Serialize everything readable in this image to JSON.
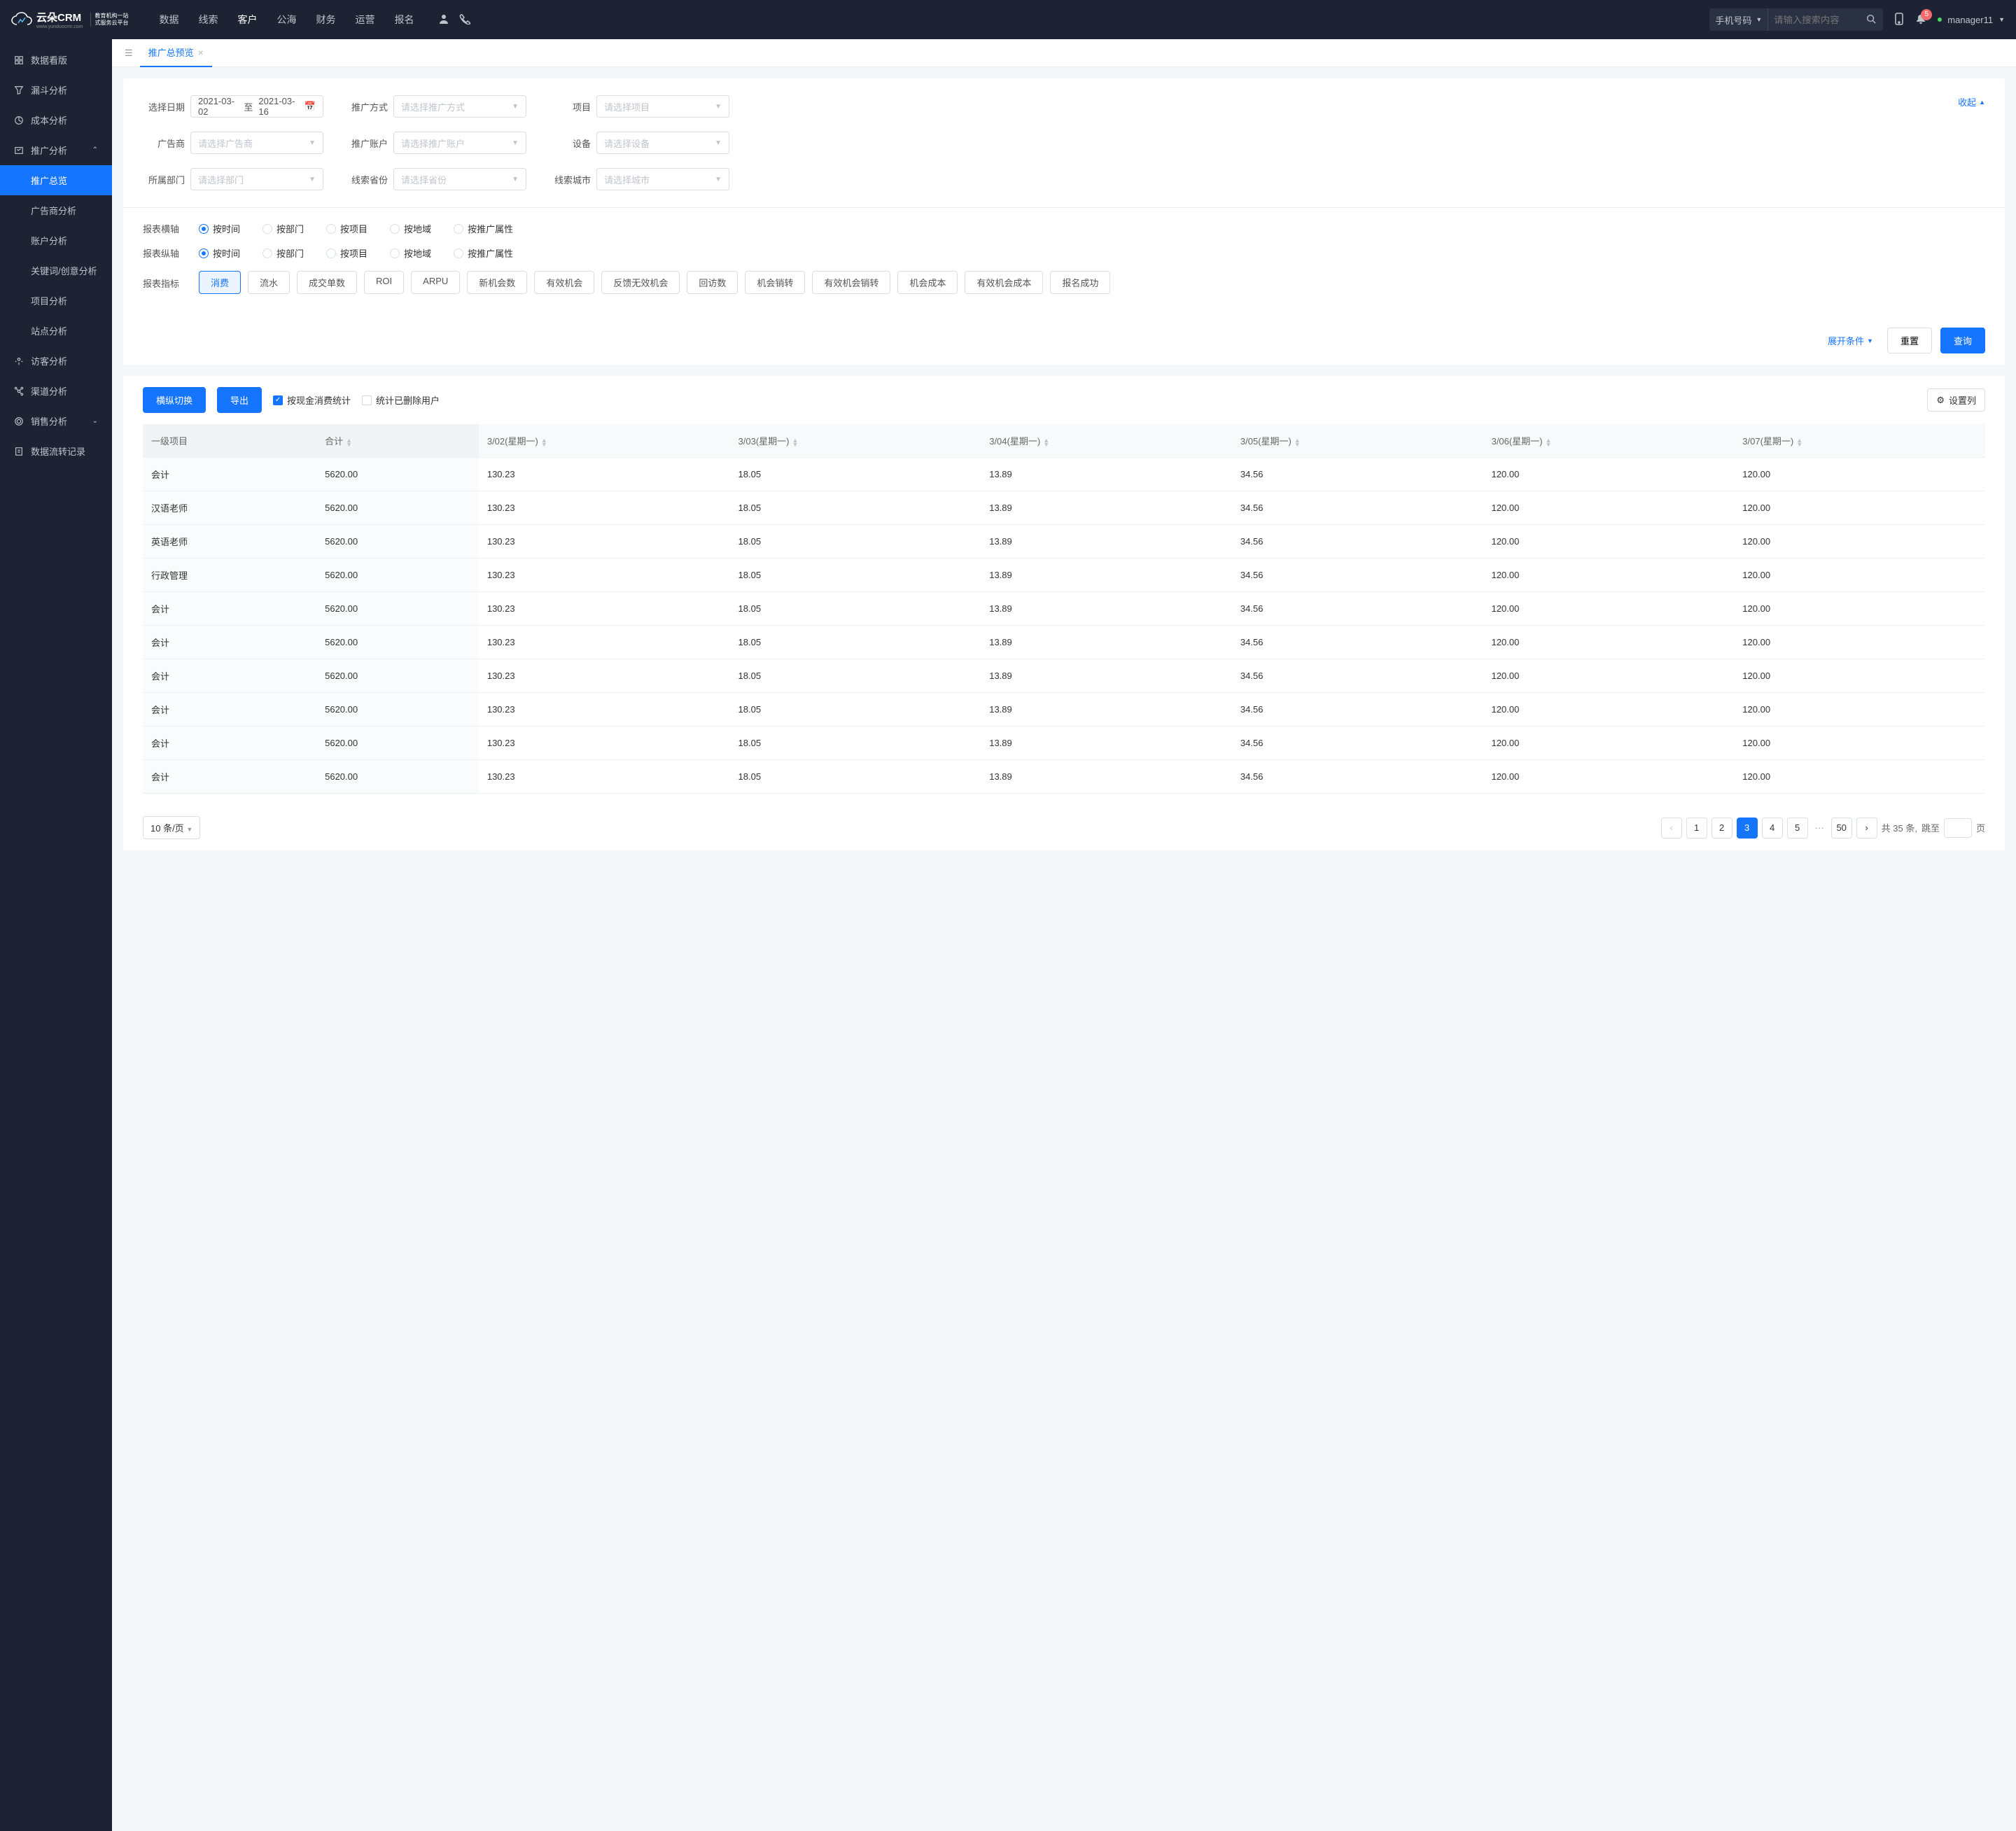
{
  "header": {
    "logo_text": "云朵CRM",
    "logo_url": "www.yunduocrm.com",
    "logo_sub_line1": "教育机构一站",
    "logo_sub_line2": "式服务云平台",
    "nav": [
      "数据",
      "线索",
      "客户",
      "公海",
      "财务",
      "运营",
      "报名"
    ],
    "nav_active_index": 2,
    "search_type": "手机号码",
    "search_placeholder": "请输入搜索内容",
    "notification_count": "5",
    "user_name": "manager11"
  },
  "sidebar": {
    "items": [
      {
        "icon": "dashboard",
        "label": "数据看版"
      },
      {
        "icon": "funnel",
        "label": "漏斗分析"
      },
      {
        "icon": "cost",
        "label": "成本分析"
      },
      {
        "icon": "promo",
        "label": "推广分析",
        "expanded": true,
        "children": [
          {
            "label": "推广总览",
            "active": true
          },
          {
            "label": "广告商分析"
          },
          {
            "label": "账户分析"
          },
          {
            "label": "关键词/创意分析"
          },
          {
            "label": "项目分析"
          },
          {
            "label": "站点分析"
          }
        ]
      },
      {
        "icon": "visitor",
        "label": "访客分析"
      },
      {
        "icon": "channel",
        "label": "渠道分析"
      },
      {
        "icon": "sales",
        "label": "销售分析",
        "expandable": true
      },
      {
        "icon": "flow",
        "label": "数据流转记录"
      }
    ]
  },
  "tabs": [
    {
      "label": "推广总预览",
      "active": true
    }
  ],
  "filters": {
    "date_label": "选择日期",
    "date_from": "2021-03-02",
    "date_sep": "至",
    "date_to": "2021-03-16",
    "method_label": "推广方式",
    "method_placeholder": "请选择推广方式",
    "project_label": "项目",
    "project_placeholder": "请选择项目",
    "advertiser_label": "广告商",
    "advertiser_placeholder": "请选择广告商",
    "account_label": "推广账户",
    "account_placeholder": "请选择推广账户",
    "device_label": "设备",
    "device_placeholder": "请选择设备",
    "dept_label": "所属部门",
    "dept_placeholder": "请选择部门",
    "province_label": "线索省份",
    "province_placeholder": "请选择省份",
    "city_label": "线索城市",
    "city_placeholder": "请选择城市",
    "collapse_text": "收起"
  },
  "report": {
    "x_axis_label": "报表横轴",
    "y_axis_label": "报表纵轴",
    "axis_options": [
      "按时间",
      "按部门",
      "按项目",
      "按地域",
      "按推广属性"
    ],
    "x_selected": 0,
    "y_selected": 0,
    "metric_label": "报表指标",
    "metric_options": [
      "消费",
      "流水",
      "成交单数",
      "ROI",
      "ARPU",
      "新机会数",
      "有效机会",
      "反馈无效机会",
      "回访数",
      "机会销转",
      "有效机会销转",
      "机会成本",
      "有效机会成本",
      "报名成功"
    ],
    "metric_selected": 0
  },
  "actions": {
    "expand_text": "展开条件",
    "reset_text": "重置",
    "query_text": "查询"
  },
  "toolbar": {
    "switch_btn": "横纵切换",
    "export_btn": "导出",
    "cash_check": "按现金消费统计",
    "deleted_check": "统计已删除用户",
    "settings_btn": "设置列"
  },
  "table": {
    "headers": [
      "一级项目",
      "合计",
      "3/02(星期一)",
      "3/03(星期一)",
      "3/04(星期一)",
      "3/05(星期一)",
      "3/06(星期一)",
      "3/07(星期一)"
    ],
    "rows": [
      [
        "会计",
        "5620.00",
        "130.23",
        "18.05",
        "13.89",
        "34.56",
        "120.00",
        "120.00"
      ],
      [
        "汉语老师",
        "5620.00",
        "130.23",
        "18.05",
        "13.89",
        "34.56",
        "120.00",
        "120.00"
      ],
      [
        "英语老师",
        "5620.00",
        "130.23",
        "18.05",
        "13.89",
        "34.56",
        "120.00",
        "120.00"
      ],
      [
        "行政管理",
        "5620.00",
        "130.23",
        "18.05",
        "13.89",
        "34.56",
        "120.00",
        "120.00"
      ],
      [
        "会计",
        "5620.00",
        "130.23",
        "18.05",
        "13.89",
        "34.56",
        "120.00",
        "120.00"
      ],
      [
        "会计",
        "5620.00",
        "130.23",
        "18.05",
        "13.89",
        "34.56",
        "120.00",
        "120.00"
      ],
      [
        "会计",
        "5620.00",
        "130.23",
        "18.05",
        "13.89",
        "34.56",
        "120.00",
        "120.00"
      ],
      [
        "会计",
        "5620.00",
        "130.23",
        "18.05",
        "13.89",
        "34.56",
        "120.00",
        "120.00"
      ],
      [
        "会计",
        "5620.00",
        "130.23",
        "18.05",
        "13.89",
        "34.56",
        "120.00",
        "120.00"
      ],
      [
        "会计",
        "5620.00",
        "130.23",
        "18.05",
        "13.89",
        "34.56",
        "120.00",
        "120.00"
      ]
    ]
  },
  "pagination": {
    "page_size_text": "10 条/页",
    "pages": [
      "1",
      "2",
      "3",
      "4",
      "5"
    ],
    "last_page": "50",
    "active_page_index": 2,
    "total_prefix": "共",
    "total_count": "35",
    "total_suffix": "条,",
    "jump_prefix": "跳至",
    "jump_suffix": "页"
  }
}
